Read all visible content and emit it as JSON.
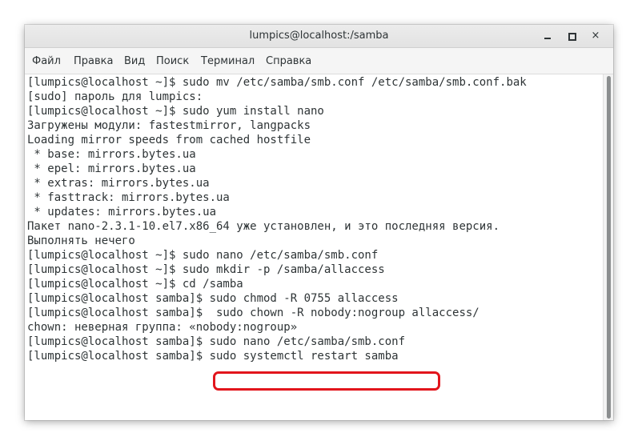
{
  "window": {
    "title": "lumpics@localhost:/samba"
  },
  "controls": {
    "close_glyph": "×"
  },
  "menu": {
    "items": [
      "Файл",
      "Правка",
      "Вид",
      "Поиск",
      "Терминал",
      "Справка"
    ]
  },
  "terminal": {
    "lines": [
      "[lumpics@localhost ~]$ sudo mv /etc/samba/smb.conf /etc/samba/smb.conf.bak",
      "[sudo] пароль для lumpics:",
      "[lumpics@localhost ~]$ sudo yum install nano",
      "Загружены модули: fastestmirror, langpacks",
      "Loading mirror speeds from cached hostfile",
      " * base: mirrors.bytes.ua",
      " * epel: mirrors.bytes.ua",
      " * extras: mirrors.bytes.ua",
      " * fasttrack: mirrors.bytes.ua",
      " * updates: mirrors.bytes.ua",
      "Пакет nano-2.3.1-10.el7.x86_64 уже установлен, и это последняя версия.",
      "Выполнять нечего",
      "[lumpics@localhost ~]$ sudo nano /etc/samba/smb.conf",
      "[lumpics@localhost ~]$ sudo mkdir -p /samba/allaccess",
      "[lumpics@localhost ~]$ cd /samba",
      "[lumpics@localhost samba]$ sudo chmod -R 0755 allaccess",
      "[lumpics@localhost samba]$  sudo chown -R nobody:nogroup allaccess/",
      "chown: неверная группа: «nobody:nogroup»",
      "[lumpics@localhost samba]$ sudo nano /etc/samba/smb.conf",
      "[lumpics@localhost samba]$ sudo systemctl restart samba"
    ]
  },
  "colors": {
    "highlight": "#e2151c",
    "terminal_text": "#2e3436"
  }
}
